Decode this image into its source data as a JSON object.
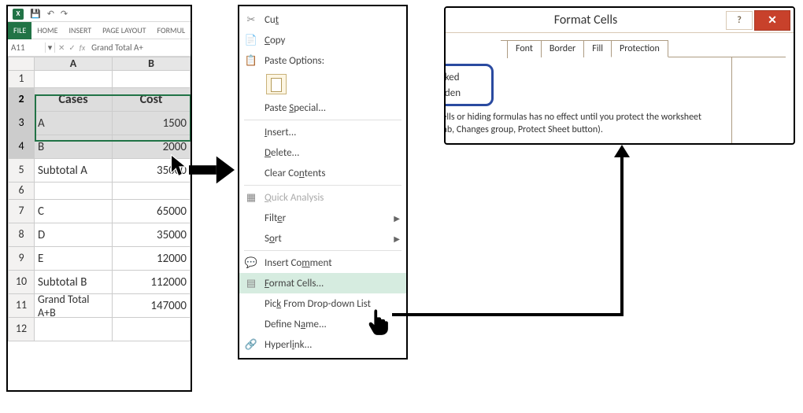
{
  "qat": {
    "save": "💾",
    "undo": "↶",
    "redo": "↷"
  },
  "ribbon": {
    "file": "FILE",
    "home": "HOME",
    "insert": "INSERT",
    "page_layout": "PAGE LAYOUT",
    "formulas": "FORMUL"
  },
  "namebox": {
    "ref": "A11",
    "formula": "Grand Total A+"
  },
  "grid": {
    "col_a": "A",
    "col_b": "B",
    "rows": [
      {
        "n": "1",
        "a": "",
        "b": ""
      },
      {
        "n": "2",
        "a": "Cases",
        "b": "Cost"
      },
      {
        "n": "3",
        "a": "A",
        "b": "1500"
      },
      {
        "n": "4",
        "a": "B",
        "b": "2000"
      },
      {
        "n": "5",
        "a": "Subtotal A",
        "b": "35000"
      },
      {
        "n": "6",
        "a": "",
        "b": ""
      },
      {
        "n": "7",
        "a": "C",
        "b": "65000"
      },
      {
        "n": "8",
        "a": "D",
        "b": "35000"
      },
      {
        "n": "9",
        "a": "E",
        "b": "12000"
      },
      {
        "n": "10",
        "a": "Subtotal B",
        "b": "112000"
      },
      {
        "n": "11",
        "a": "Grand Total A+B",
        "b": "147000"
      },
      {
        "n": "12",
        "a": "",
        "b": ""
      }
    ]
  },
  "ctx": {
    "cut": "Cut",
    "copy": "Copy",
    "paste_options": "Paste Options:",
    "paste_special": "Paste Special...",
    "insert": "Insert...",
    "delete": "Delete...",
    "clear_contents": "Clear Contents",
    "quick_analysis": "Quick Analysis",
    "filter": "Filter",
    "sort": "Sort",
    "insert_comment": "Insert Comment",
    "format_cells": "Format Cells...",
    "pick_list": "Pick From Drop-down List",
    "define_name": "Define Name...",
    "hyperlink": "Hyperlink..."
  },
  "dlg": {
    "title": "Format Cells",
    "help": "?",
    "close": "✕",
    "tabs": {
      "font": "Font",
      "border": "Border",
      "fill": "Fill",
      "protection": "Protection"
    },
    "locked": "Locked",
    "hidden": "Hidden",
    "help_text": "Locking cells or hiding formulas has no effect until you protect the worksheet (Review tab, Changes group, Protect Sheet button)."
  }
}
